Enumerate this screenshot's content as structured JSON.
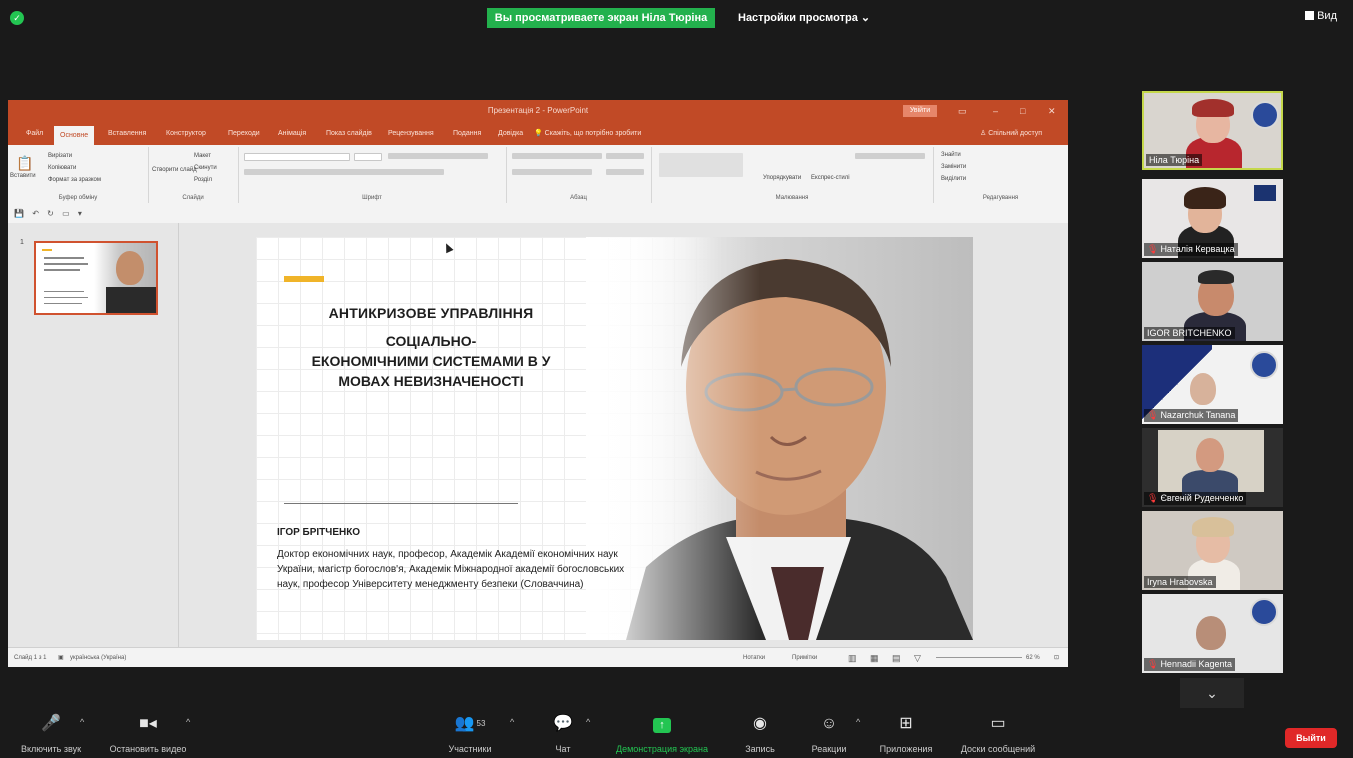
{
  "zoom": {
    "viewing_banner": "Вы просматриваете экран Ніла Тюріна",
    "view_options": "Настройки просмотра",
    "view_button": "Вид"
  },
  "ppt": {
    "window_title": "Презентація 2 - PowerPoint",
    "account": "Увійти",
    "tabs": [
      "Файл",
      "Основне",
      "Вставлення",
      "Конструктор",
      "Переходи",
      "Анімація",
      "Показ слайдів",
      "Рецензування",
      "Подання",
      "Довідка"
    ],
    "tell_me": "Скажіть, що потрібно зробити",
    "share": "Спільний доступ",
    "ribbon_groups": [
      "Буфер обміну",
      "Слайди",
      "Шрифт",
      "Абзац",
      "Малювання",
      "Редагування"
    ],
    "ribbon_commands": {
      "paste": "Вставити",
      "cut": "Вирізати",
      "copy": "Копіювати",
      "format_painter": "Формат за зразком",
      "new_slide": "Створити слайд",
      "layout": "Макет",
      "reset": "Скинути",
      "section": "Розділ",
      "arrange": "Упорядкувати",
      "quick_styles": "Експрес-стилі",
      "find": "Знайти",
      "replace": "Замінити",
      "select": "Виділити"
    },
    "status": {
      "slide": "Слайд 1 з 1",
      "language": "українська (Україна)",
      "notes": "Нотатки",
      "comments": "Примітки",
      "zoom": "62 %"
    }
  },
  "slide": {
    "title_line1": "АНТИКРИЗОВЕ УПРАВЛІННЯ",
    "title_line2": "СОЦІАЛЬНО-",
    "title_line3": "ЕКОНОМІЧНИМИ СИСТЕМАМИ В У",
    "title_line4": "МОВАХ НЕВИЗНАЧЕНОСТІ",
    "author": "ІГОР БРІТЧЕНКО",
    "bio": "Доктор економічних наук, професор, Академік Академії економічних наук України, магістр богослов'я, Академік Міжнародної академії богословських наук, професор Університету менеджменту безпеки (Словаччина)"
  },
  "participants": [
    {
      "name": "Ніла Тюріна",
      "muted": false
    },
    {
      "name": "Наталія Кервацка",
      "muted": true
    },
    {
      "name": "IGOR BRITCHENKO",
      "muted": false
    },
    {
      "name": "Nazarchuk Tanana",
      "muted": true
    },
    {
      "name": "Євгеній Руденченко",
      "muted": true
    },
    {
      "name": "Iryna Hrabovska",
      "muted": false
    },
    {
      "name": "Hennadii Kagenta",
      "muted": true
    }
  ],
  "toolbar": {
    "unmute": "Включить звук",
    "stop_video": "Остановить видео",
    "participants": "Участники",
    "participants_count": "53",
    "chat": "Чат",
    "share": "Демонстрация экрана",
    "record": "Запись",
    "reactions": "Реакции",
    "apps": "Приложения",
    "whiteboards": "Доски сообщений",
    "leave": "Выйти"
  },
  "colors": {
    "ppt_accent": "#c14a26",
    "zoom_green": "#23b14d",
    "leave_red": "#e02828"
  }
}
